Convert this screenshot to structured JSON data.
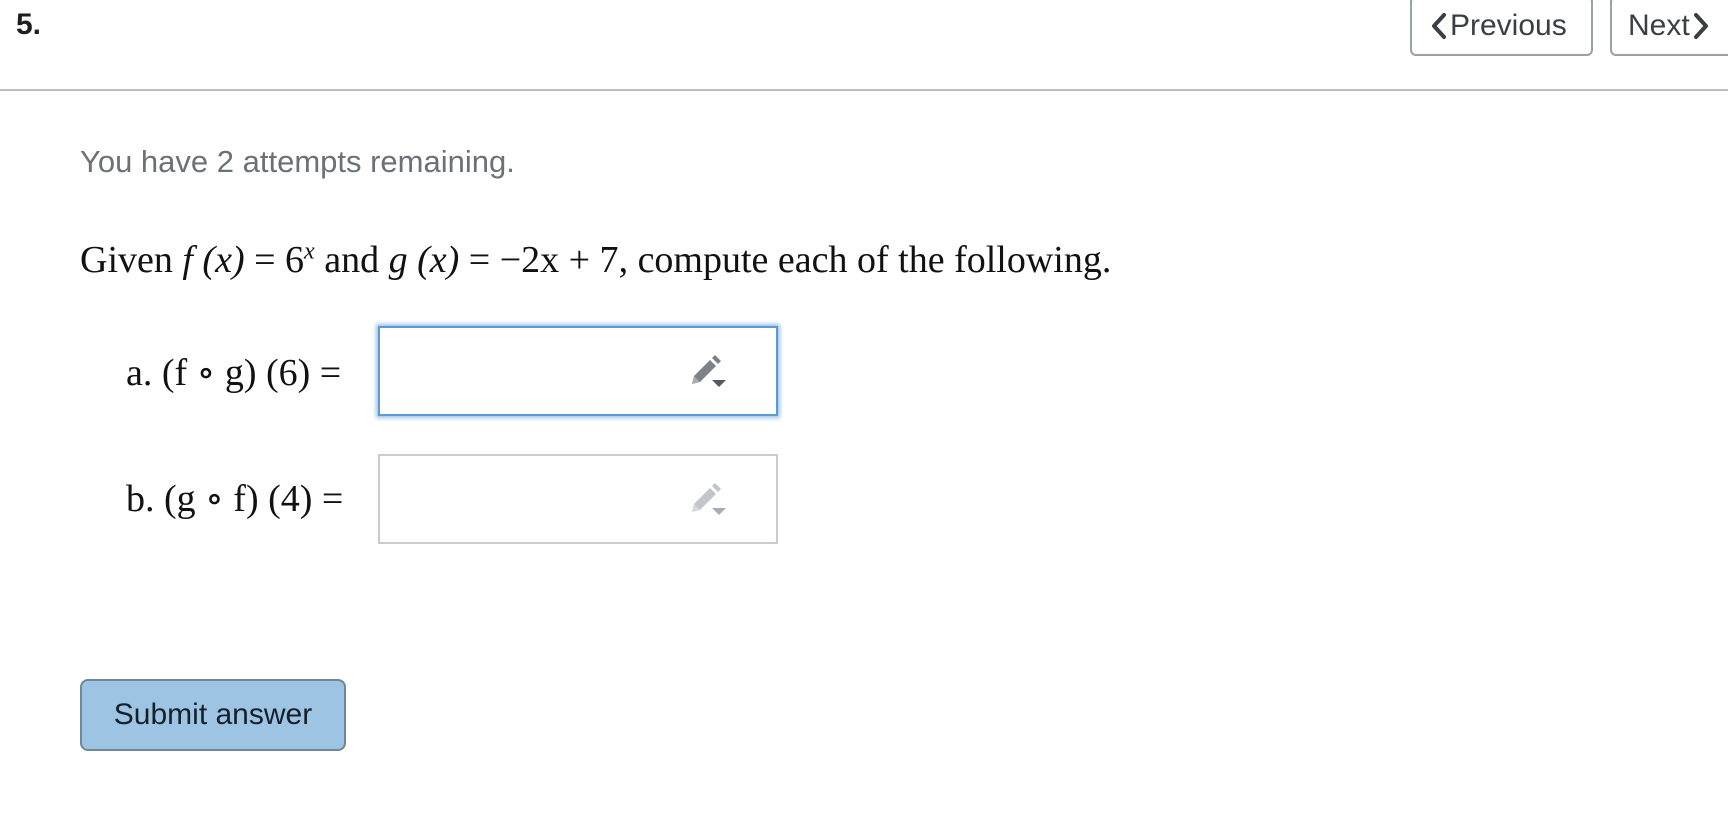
{
  "question": {
    "number": "5."
  },
  "nav": {
    "previous_label": "Previous",
    "next_label": "Next"
  },
  "attempts_text": "You have 2 attempts remaining.",
  "problem": {
    "given": "Given",
    "f_def_lhs": "f (x)",
    "f_def_eq": " = 6",
    "f_def_exp": "x",
    "and": " and ",
    "g_def_lhs": "g (x)",
    "g_def_rhs": " = −2x + 7",
    "tail": ", compute each of the following."
  },
  "parts": [
    {
      "label": "a.",
      "expression": "(f ∘ g) (6) =",
      "value": ""
    },
    {
      "label": "b.",
      "expression": "(g ∘ f) (4) =",
      "value": ""
    }
  ],
  "submit_label": "Submit answer",
  "icons": {
    "prev": "chevron-left-icon",
    "next": "chevron-right-icon",
    "edit": "pencil-dropdown-icon"
  },
  "colors": {
    "accent": "#9ec4e4",
    "focus": "#5b9bd5"
  }
}
